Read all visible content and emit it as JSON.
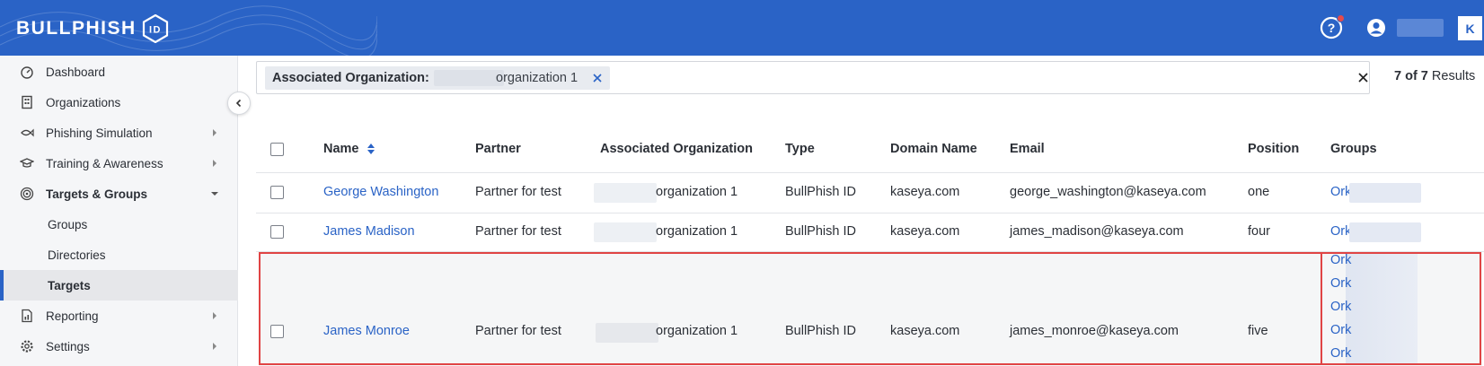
{
  "header": {
    "logo_bold": "BULLPHISH",
    "logo_badge": "ID",
    "brand_mark": "K"
  },
  "sidebar": {
    "items": [
      {
        "label": "Dashboard",
        "icon": "dashboard-icon"
      },
      {
        "label": "Organizations",
        "icon": "building-icon"
      },
      {
        "label": "Phishing Simulation",
        "icon": "fish-icon",
        "has_children": true
      },
      {
        "label": "Training & Awareness",
        "icon": "graduation-cap-icon",
        "has_children": true
      },
      {
        "label": "Targets & Groups",
        "icon": "target-icon",
        "expanded": true
      },
      {
        "label": "Groups",
        "sub": true
      },
      {
        "label": "Directories",
        "sub": true
      },
      {
        "label": "Targets",
        "sub": true,
        "active": true
      },
      {
        "label": "Reporting",
        "icon": "report-icon",
        "has_children": true
      },
      {
        "label": "Settings",
        "icon": "gear-icon",
        "has_children": true
      }
    ]
  },
  "filter": {
    "chip_label": "Associated Organization:",
    "chip_value": "organization 1",
    "results_count": "7 of 7",
    "results_label": "Results"
  },
  "table": {
    "columns": [
      "Name",
      "Partner",
      "Associated Organization",
      "Type",
      "Domain Name",
      "Email",
      "Position",
      "Groups"
    ],
    "rows": [
      {
        "name": "George Washington",
        "partner": "Partner for test",
        "org": "organization 1",
        "type": "BullPhish ID",
        "domain": "kaseya.com",
        "email": "george_washington@kaseya.com",
        "position": "one",
        "groups": [
          "Ork"
        ]
      },
      {
        "name": "James Madison",
        "partner": "Partner for test",
        "org": "organization 1",
        "type": "BullPhish ID",
        "domain": "kaseya.com",
        "email": "james_madison@kaseya.com",
        "position": "four",
        "groups": [
          "Ork"
        ]
      },
      {
        "name": "James Monroe",
        "partner": "Partner for test",
        "org": "organization 1",
        "type": "BullPhish ID",
        "domain": "kaseya.com",
        "email": "james_monroe@kaseya.com",
        "position": "five",
        "groups": [
          "Ork",
          "Ork",
          "Ork",
          "Ork",
          "Ork"
        ]
      }
    ]
  },
  "colors": {
    "brand_blue": "#2a63c6",
    "highlight_red": "#e04444",
    "link_blue": "#2a63c6"
  }
}
